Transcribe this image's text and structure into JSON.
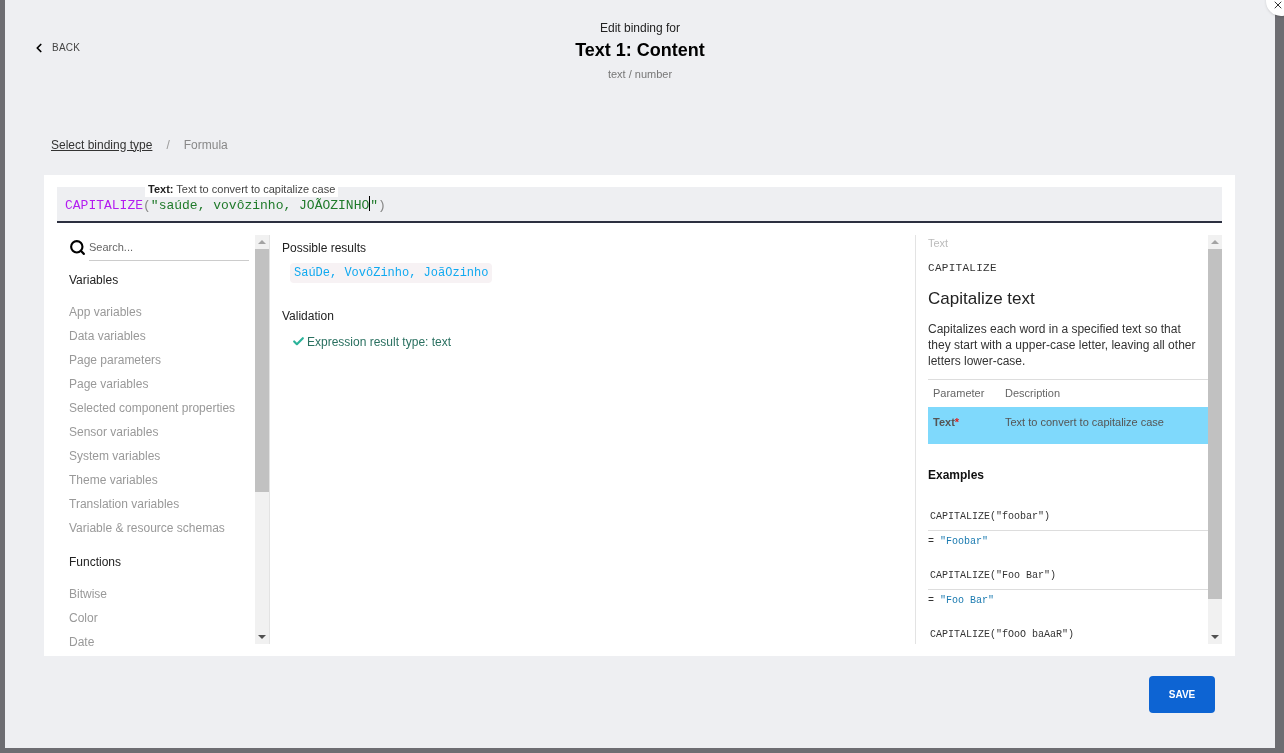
{
  "header": {
    "back": "BACK",
    "subtitle": "Edit binding for",
    "title": "Text 1: Content",
    "type": "text / number"
  },
  "breadcrumb": [
    {
      "label": "Select binding type",
      "kind": "link"
    },
    {
      "label": "/",
      "kind": "separator"
    },
    {
      "label": "Formula",
      "kind": "current"
    }
  ],
  "tooltip": {
    "label": "Text:",
    "text": "Text to convert to capitalize case"
  },
  "formula": [
    {
      "kind": "function",
      "text": "CAPITALIZE"
    },
    {
      "kind": "punct",
      "text": "("
    },
    {
      "kind": "string",
      "text": "\"saúde, vovôzinho, JOÃOZINHO"
    },
    {
      "kind": "cursor"
    },
    {
      "kind": "string",
      "text": "\""
    },
    {
      "kind": "punct",
      "text": ")"
    }
  ],
  "sidebar": {
    "search": {
      "placeholder": "Search..."
    },
    "sections": [
      {
        "heading": "Variables",
        "items": [
          "App variables",
          "Data variables",
          "Page parameters",
          "Page variables",
          "Selected component properties",
          "Sensor variables",
          "System variables",
          "Theme variables",
          "Translation variables",
          "Variable & resource schemas"
        ]
      },
      {
        "heading": "Functions",
        "items": [
          "Bitwise",
          "Color",
          "Date"
        ]
      }
    ]
  },
  "results": {
    "heading": "Possible results",
    "value": "SaúDe, VovôZinho, JoãOzinho"
  },
  "validation": {
    "heading": "Validation",
    "messages": [
      {
        "text": "Expression result type: text",
        "ok": true
      }
    ]
  },
  "docs": {
    "category": "Text",
    "name": "CAPITALIZE",
    "title": "Capitalize text",
    "description": "Capitalizes each word in a specified text so that they start with a upper-case letter, leaving all other letters lower-case.",
    "columns": [
      "Parameter",
      "Description"
    ],
    "required_mark": "*",
    "result_prefix": "=",
    "parameters": [
      {
        "name": "Text",
        "required": true,
        "description": "Text to convert to capitalize case",
        "selected": true
      }
    ],
    "examples_heading": "Examples",
    "examples": [
      {
        "code": "CAPITALIZE(\"foobar\")",
        "result": "\"Foobar\""
      },
      {
        "code": "CAPITALIZE(\"Foo Bar\")",
        "result": "\"Foo Bar\""
      },
      {
        "code": "CAPITALIZE(\"fOoO baAaR\")"
      }
    ]
  },
  "save": "SAVE"
}
